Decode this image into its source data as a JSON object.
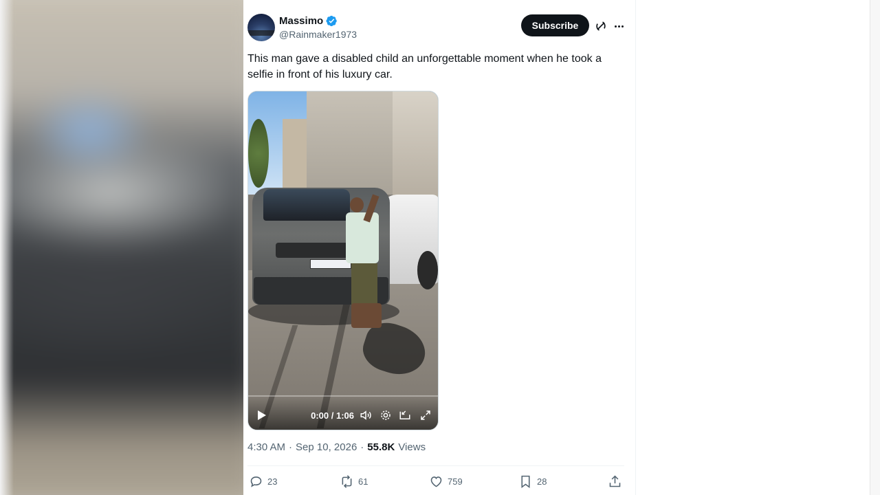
{
  "author": {
    "display_name": "Massimo",
    "handle": "@Rainmaker1973",
    "verified": true
  },
  "header": {
    "subscribe_label": "Subscribe",
    "icons": [
      "verified-badge-icon",
      "grok-icon",
      "more-icon"
    ]
  },
  "tweet": {
    "text": "This man gave a disabled child an unforgettable moment when he took a selfie in front of his luxury car."
  },
  "video": {
    "time": "0:00 / 1:06",
    "progress": 0,
    "icons": [
      "play-icon",
      "volume-icon",
      "settings-icon",
      "pip-icon",
      "fullscreen-icon"
    ]
  },
  "meta": {
    "time": "4:30 AM",
    "date": "Sep 10, 2026",
    "views_count": "55.8K",
    "views_label": "Views",
    "separator": "·"
  },
  "actions": {
    "replies": "23",
    "reposts": "61",
    "likes": "759",
    "bookmarks": "28"
  },
  "colors": {
    "accent": "#1d9bf0",
    "text": "#0f1419",
    "secondary": "#536471",
    "border": "#eff3f4"
  }
}
